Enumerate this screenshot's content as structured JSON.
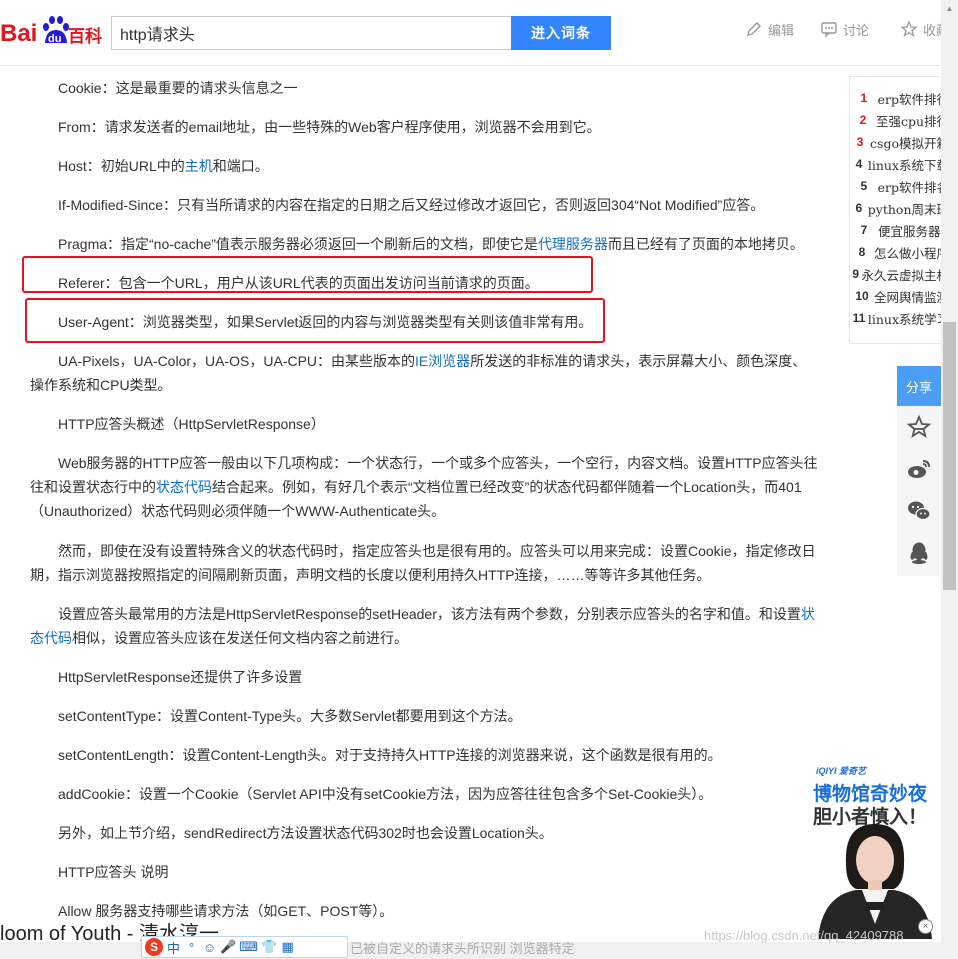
{
  "header": {
    "logo_text_bai": "Bai",
    "logo_text_du": "du",
    "logo_text_baike": "百科",
    "search_value": "http请求头",
    "search_button": "进入词条",
    "actions": [
      {
        "label": "编辑",
        "icon": "pencil-icon"
      },
      {
        "label": "讨论",
        "icon": "chat-icon"
      },
      {
        "label": "收藏",
        "icon": "star-icon"
      }
    ]
  },
  "article": {
    "paragraphs": [
      {
        "parts": [
          {
            "text": "Cookie：这是最重要的请求头信息之一"
          }
        ]
      },
      {
        "parts": [
          {
            "text": "From：请求发送者的email地址，由一些特殊的Web客户程序使用，浏览器不会用到它。"
          }
        ]
      },
      {
        "parts": [
          {
            "text": "Host：初始URL中的"
          },
          {
            "text": "主机",
            "link": true
          },
          {
            "text": "和端口。"
          }
        ]
      },
      {
        "parts": [
          {
            "text": "If-Modified-Since：只有当所请求的内容在指定的日期之后又经过修改才返回它，否则返回304“Not Modified”应答。"
          }
        ]
      },
      {
        "parts": [
          {
            "text": "Pragma：指定“no-cache”值表示服务器必须返回一个刷新后的文档，即使它是"
          },
          {
            "text": "代理服务器",
            "link": true
          },
          {
            "text": "而且已经有了页面的本地拷贝。"
          }
        ]
      },
      {
        "parts": [
          {
            "text": "Referer：包含一个URL，用户从该URL代表的页面出发访问当前请求的页面。"
          }
        ]
      },
      {
        "parts": [
          {
            "text": "User-Agent：浏览器类型，如果Servlet返回的内容与浏览器类型有关则该值非常有用。"
          }
        ]
      },
      {
        "parts": [
          {
            "text": "UA-Pixels，UA-Color，UA-OS，UA-CPU：由某些版本的"
          },
          {
            "text": "IE浏览器",
            "link": true
          },
          {
            "text": "所发送的非标准的请求头，表示屏幕大小、颜色深度、操作系统和CPU类型。"
          }
        ]
      },
      {
        "parts": [
          {
            "text": "HTTP应答头概述（HttpServletResponse）"
          }
        ]
      },
      {
        "parts": [
          {
            "text": "Web服务器的HTTP应答一般由以下几项构成：一个状态行，一个或多个应答头，一个空行，内容文档。设置HTTP应答头往往和设置状态行中的"
          },
          {
            "text": "状态代码",
            "link": true
          },
          {
            "text": "结合起来。例如，有好几个表示“文档位置已经改变”的状态代码都伴随着一个Location头，而401（Unauthorized）状态代码则必须伴随一个WWW-Authenticate头。"
          }
        ]
      },
      {
        "parts": [
          {
            "text": "然而，即使在没有设置特殊含义的状态代码时，指定应答头也是很有用的。应答头可以用来完成：设置Cookie，指定修改日期，指示浏览器按照指定的间隔刷新页面，声明文档的长度以便利用持久HTTP连接，……等等许多其他任务。"
          }
        ]
      },
      {
        "parts": [
          {
            "text": "设置应答头最常用的方法是HttpServletResponse的setHeader，该方法有两个参数，分别表示应答头的名字和值。和设置"
          },
          {
            "text": "状态代码",
            "link": true
          },
          {
            "text": "相似，设置应答头应该在发送任何文档内容之前进行。"
          }
        ]
      },
      {
        "parts": [
          {
            "text": "HttpServletResponse还提供了许多设置"
          }
        ]
      },
      {
        "parts": [
          {
            "text": "setContentType：设置Content-Type头。大多数Servlet都要用到这个方法。"
          }
        ]
      },
      {
        "parts": [
          {
            "text": "setContentLength：设置Content-Length头。对于支持持久HTTP连接的浏览器来说，这个函数是很有用的。"
          }
        ]
      },
      {
        "parts": [
          {
            "text": "addCookie：设置一个Cookie（Servlet API中没有setCookie方法，因为应答往往包含多个Set-Cookie头）。"
          }
        ]
      },
      {
        "parts": [
          {
            "text": "另外，如上节介绍，sendRedirect方法设置状态代码302时也会设置Location头。"
          }
        ]
      },
      {
        "parts": [
          {
            "text": "HTTP应答头 说明"
          }
        ]
      },
      {
        "parts": [
          {
            "text": "Allow 服务器支持哪些请求方法（如GET、POST等）。"
          }
        ]
      }
    ]
  },
  "hot_list": [
    {
      "rank": "1",
      "title": "erp软件排行"
    },
    {
      "rank": "2",
      "title": "至强cpu排行"
    },
    {
      "rank": "3",
      "title": "csgo模拟开箱"
    },
    {
      "rank": "4",
      "title": "linux系统下载"
    },
    {
      "rank": "5",
      "title": "erp软件排名"
    },
    {
      "rank": "6",
      "title": "python周末班"
    },
    {
      "rank": "7",
      "title": "便宜服务器"
    },
    {
      "rank": "8",
      "title": "怎么做小程序"
    },
    {
      "rank": "9",
      "title": "永久云虚拟主机"
    },
    {
      "rank": "10",
      "title": "全网舆情监测"
    },
    {
      "rank": "11",
      "title": "linux系统学习"
    }
  ],
  "share": {
    "label": "分享",
    "icons": [
      "star-icon",
      "weibo-icon",
      "wechat-icon",
      "qq-icon"
    ]
  },
  "ad": {
    "brand": "iQIYI 爱奇艺",
    "title_line1": "博物馆奇妙夜",
    "title_line2": "胆小者慎入！",
    "close": "×"
  },
  "overlay": {
    "song": "loom of Youth - 清水淳一",
    "watermark": "https://blog.csdn.net/qq_42409788",
    "bottom_faint": "已被自定义的请求头所识别       浏览器特定",
    "ime_logo": "S",
    "ime_items": [
      "中",
      "°",
      "☺",
      "🎤",
      "⌨",
      "👕",
      "▦"
    ]
  },
  "colors": {
    "link": "#136ec2",
    "highlight_border": "#e4131d",
    "search_button": "#3385ff",
    "share_button": "#4b9ef3",
    "baidu_red": "#e4131d",
    "baidu_blue": "#2319dc"
  }
}
